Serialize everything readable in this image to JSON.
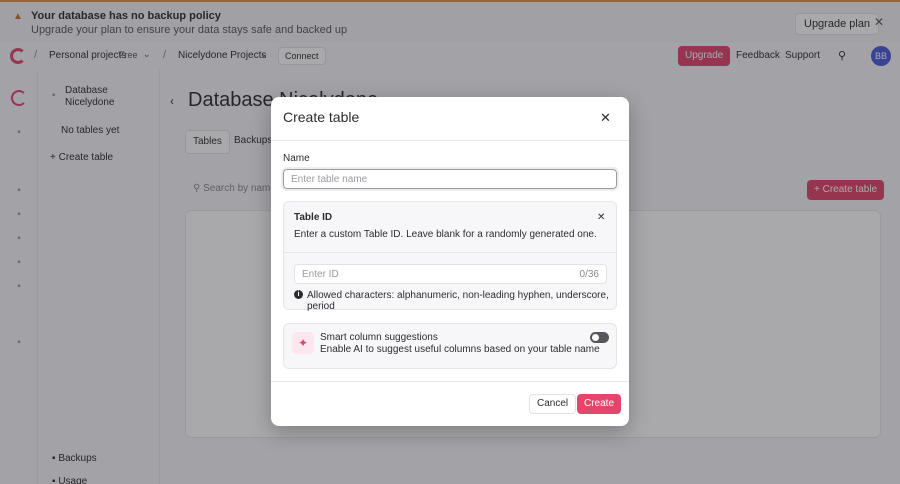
{
  "banner": {
    "title": "Your database has no backup policy",
    "subtitle": "Upgrade your plan to ensure your data stays safe and backed up",
    "upgrade_plan_label": "Upgrade plan",
    "close_glyph": "✕",
    "warning_glyph": "▲"
  },
  "topnav": {
    "personal_projects": "Personal projects",
    "plan_badge": "Free",
    "project_name": "Nicelydone Projects",
    "connect_label": "Connect",
    "upgrade_label": "Upgrade",
    "feedback_label": "Feedback",
    "support_label": "Support",
    "avatar_initials": "BB"
  },
  "sidebar": {
    "database_name": "Database Nicelydone",
    "no_tables": "No tables yet",
    "create_table": "Create table",
    "backups": "Backups",
    "usage": "Usage"
  },
  "main": {
    "title": "Database Nicelydone",
    "tabs": [
      {
        "label": "Tables"
      },
      {
        "label": "Backups"
      }
    ],
    "search_placeholder": "Search by name",
    "create_table_label": "Create table"
  },
  "modal": {
    "title": "Create table",
    "close_glyph": "✕",
    "name_label": "Name",
    "name_placeholder": "Enter table name",
    "table_id": {
      "title": "Table ID",
      "close_glyph": "✕",
      "description": "Enter a custom Table ID. Leave blank for a randomly generated one.",
      "placeholder": "Enter ID",
      "counter": "0/36",
      "allowed": "Allowed characters: alphanumeric, non-leading hyphen, underscore, period"
    },
    "smart_columns": {
      "title": "Smart column suggestions",
      "description": "Enable AI to suggest useful columns based on your table name",
      "enabled": false
    },
    "cancel_label": "Cancel",
    "create_label": "Create"
  },
  "colors": {
    "accent": "#e3456b",
    "warning": "#e0904a"
  }
}
